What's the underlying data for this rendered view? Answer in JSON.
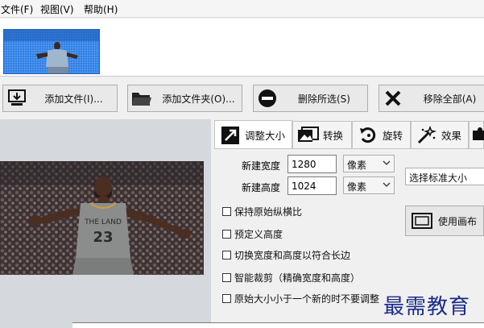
{
  "menu": {
    "file": "文件(F)",
    "view": "视图(V)",
    "help": "帮助(H)"
  },
  "toolbar": {
    "add_file": "添加文件(I)...",
    "add_folder": "添加文件夹(O)...",
    "delete_selected": "删除所选(S)",
    "remove_all": "移除全部(A)"
  },
  "tabs": {
    "resize": "调整大小",
    "convert": "转换",
    "rotate": "旋转",
    "effects": "效果"
  },
  "resize": {
    "new_width_label": "新建宽度",
    "new_width_value": "1280",
    "width_unit": "像素",
    "new_height_label": "新建高度",
    "new_height_value": "1024",
    "height_unit": "像素",
    "preset": "选择标准大小",
    "keep_ratio": "保持原始纵横比",
    "predefined_height": "预定义高度",
    "swap_dims": "切换宽度和高度以符合长边",
    "smart_crop": "智能裁剪（精确宽度和高度）",
    "no_upscale": "原始大小小于一个新的时不要调整",
    "use_canvas": "使用画布"
  },
  "preview": {
    "jersey_text": "THE LAND",
    "jersey_number": "23"
  },
  "watermark": "最需教育",
  "colors": {
    "accent": "#1b2b8c",
    "jersey": "#8a8d8c",
    "thumb_blue": "#2c7be0"
  }
}
